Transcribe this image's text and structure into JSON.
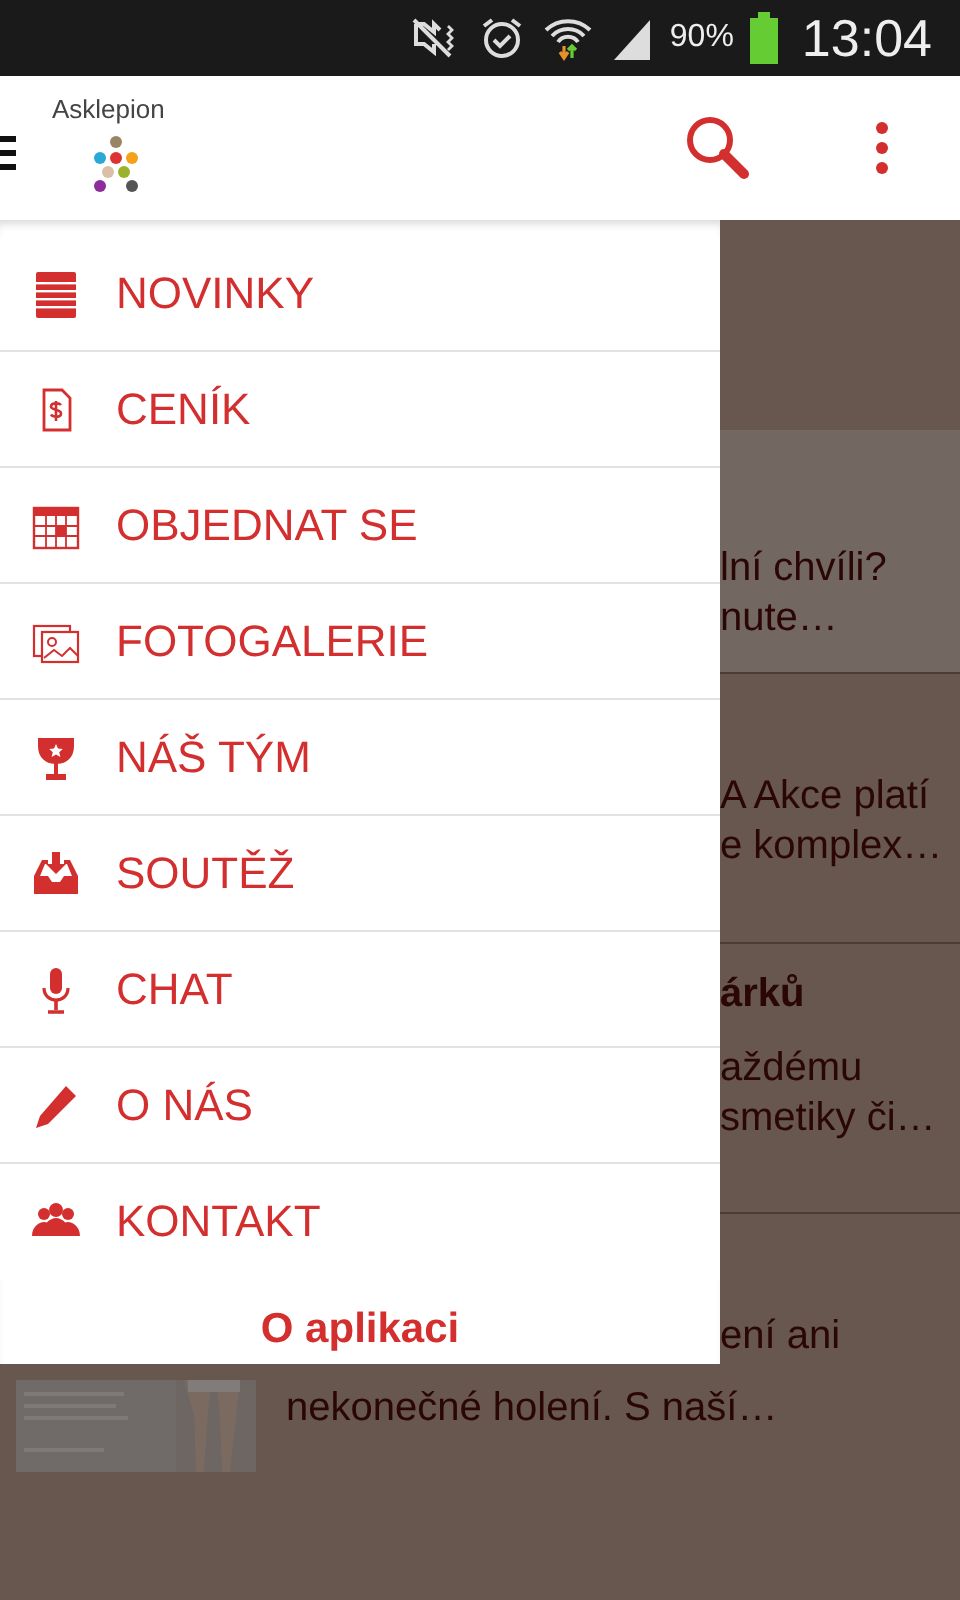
{
  "status_bar": {
    "battery": "90%",
    "time": "13:04"
  },
  "app_bar": {
    "title": "Asklepion"
  },
  "drawer": {
    "items": [
      {
        "label": "NOVINKY",
        "kind": "notepad"
      },
      {
        "label": "CENÍK",
        "kind": "price"
      },
      {
        "label": "OBJEDNAT SE",
        "kind": "calendar"
      },
      {
        "label": "FOTOGALERIE",
        "kind": "gallery"
      },
      {
        "label": "NÁŠ TÝM",
        "kind": "trophy"
      },
      {
        "label": "SOUTĚŽ",
        "kind": "inbox"
      },
      {
        "label": "CHAT",
        "kind": "mic"
      },
      {
        "label": "O NÁS",
        "kind": "pencil"
      },
      {
        "label": "KONTAKT",
        "kind": "people"
      }
    ],
    "footer": "O aplikaci"
  },
  "background_cards": [
    {
      "highlighted": true,
      "lines": [
        "lní chvíli?",
        "nute…"
      ]
    },
    {
      "highlighted": false,
      "lines": [
        "A Akce platí",
        "e komplex…"
      ]
    },
    {
      "highlighted": false,
      "title": "árků",
      "lines": [
        "aždému",
        "smetiky či…"
      ]
    },
    {
      "highlighted": false,
      "lines": [
        "ení ani"
      ]
    }
  ],
  "bottom_line": "nekonečné holení. S naší…"
}
